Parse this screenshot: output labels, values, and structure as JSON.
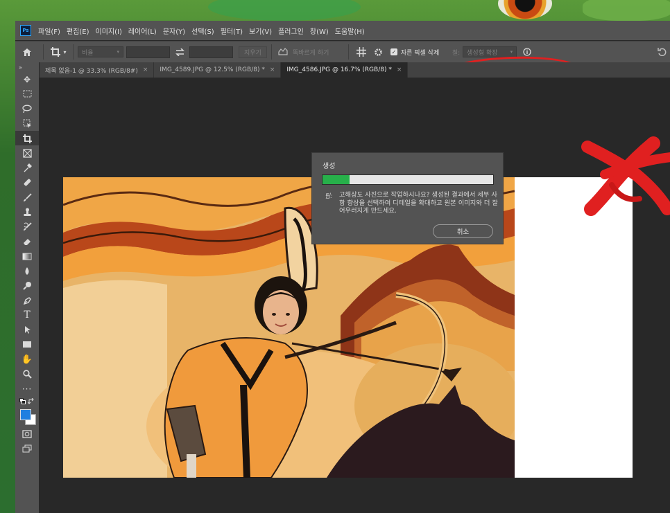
{
  "app": {
    "logo": "Ps",
    "menu": [
      "파일(F)",
      "편집(E)",
      "이미지(I)",
      "레이어(L)",
      "문자(Y)",
      "선택(S)",
      "필터(T)",
      "보기(V)",
      "플러그인",
      "창(W)",
      "도움말(H)"
    ]
  },
  "options_bar": {
    "ratio_label": "비율",
    "clear_label": "지우기",
    "straighten_label": "똑바르게 하기",
    "delete_cropped_label": "자른 픽셀 삭제",
    "fill_label": "칠:",
    "fill_value": "생성형 확장",
    "icons": [
      "home-icon",
      "crop-tool-icon",
      "swap-icon",
      "straighten-icon",
      "grid-overlay-icon",
      "settings-gear-icon",
      "info-icon",
      "reset-icon"
    ]
  },
  "tabs": [
    {
      "label": "제목 없음-1 @ 33.3% (RGB/8#)",
      "active": false
    },
    {
      "label": "IMG_4589.JPG @ 12.5% (RGB/8) *",
      "active": false
    },
    {
      "label": "IMG_4586.JPG @ 16.7% (RGB/8) *",
      "active": true
    }
  ],
  "tab_close": "×",
  "dialog": {
    "title": "생성",
    "progress": 0.16,
    "tip_label": "팁:",
    "tip_text": "고해상도 사진으로 작업하시나요? 생성된 결과에서 세부 사항 향상을 선택하여 디테일을 확대하고 원본 이미지와 더 잘 어우러지게 만드세요.",
    "cancel_label": "취소"
  },
  "tools": [
    "move-tool-icon",
    "marquee-tool-icon",
    "lasso-tool-icon",
    "object-select-tool-icon",
    "crop-tool-icon",
    "frame-tool-icon",
    "eyedropper-tool-icon",
    "healing-brush-icon",
    "brush-tool-icon",
    "stamp-tool-icon",
    "history-brush-icon",
    "eraser-tool-icon",
    "gradient-tool-icon",
    "blur-tool-icon",
    "dodge-tool-icon",
    "pen-tool-icon",
    "type-tool-icon",
    "path-select-icon",
    "rectangle-tool-icon",
    "hand-tool-icon",
    "zoom-tool-icon",
    "more-tools-icon"
  ],
  "colors": {
    "foreground": "#1f7fe0",
    "background": "#ffffff",
    "annotation": "#e02020"
  }
}
